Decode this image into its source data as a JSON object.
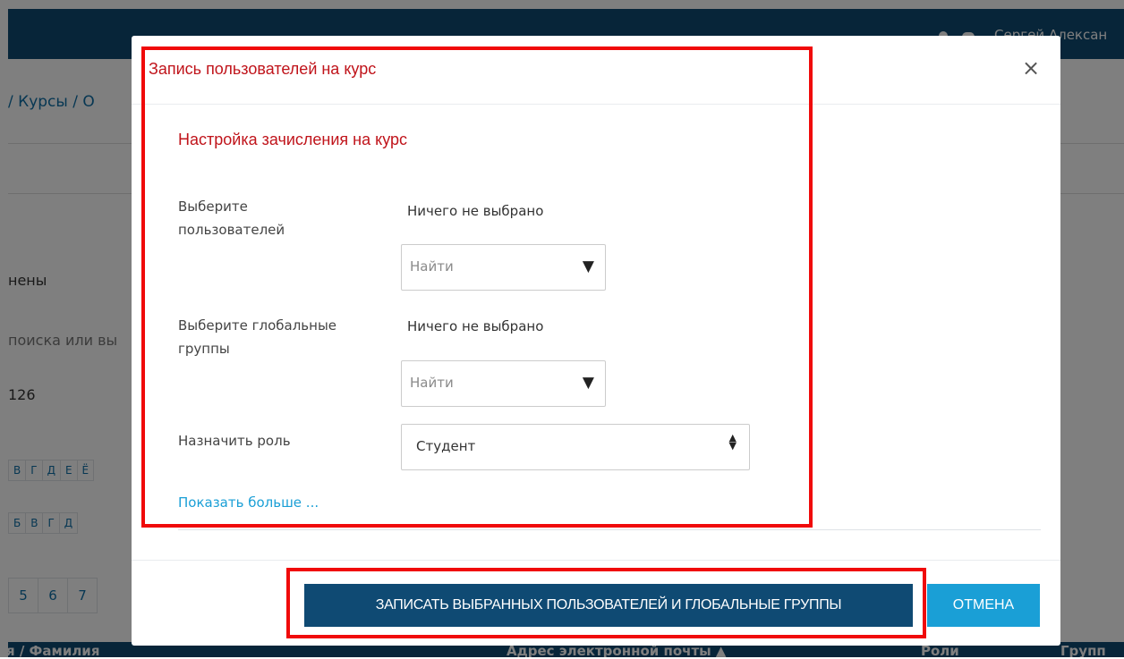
{
  "background": {
    "user_name": "Сергей Алексан",
    "breadcrumb": "/ Курсы / О",
    "enrolled_fragment": "нены",
    "search_fragment": "поиска или вы",
    "count_fragment": "126",
    "alpha_row_1": [
      "В",
      "Г",
      "Д",
      "Е",
      "Ё"
    ],
    "alpha_row_2": [
      "Б",
      "В",
      "Г",
      "Д"
    ],
    "pages": [
      "5",
      "6",
      "7"
    ],
    "table_headers": {
      "name": "я / Фамилия",
      "email": "Адрес электронной почты ▲",
      "roles": "Роли",
      "groups": "Групп"
    }
  },
  "modal": {
    "title": "Запись пользователей на курс",
    "close_symbol": "×",
    "section_title": "Настройка зачисления на курс",
    "select_users": {
      "label": "Выберите пользователей",
      "value": "Ничего не выбрано",
      "placeholder": "Найти",
      "arrow": "▼"
    },
    "select_groups": {
      "label": "Выберите глобальные группы",
      "value": "Ничего не выбрано",
      "placeholder": "Найти",
      "arrow": "▼"
    },
    "role": {
      "label": "Назначить роль",
      "value": "Студент"
    },
    "show_more": "Показать больше ...",
    "primary_button": "ЗАПИСАТЬ ВЫБРАННЫХ ПОЛЬЗОВАТЕЛЕЙ И ГЛОБАЛЬНЫЕ ГРУППЫ",
    "cancel_button": "ОТМЕНА"
  },
  "colors": {
    "header_bar": "#0f4a73",
    "title_red": "#c0141b",
    "highlight_red": "#f00a0a",
    "link_blue": "#1a9fd6",
    "primary_button": "#0f4a73",
    "cancel_button": "#1a9fd6"
  }
}
